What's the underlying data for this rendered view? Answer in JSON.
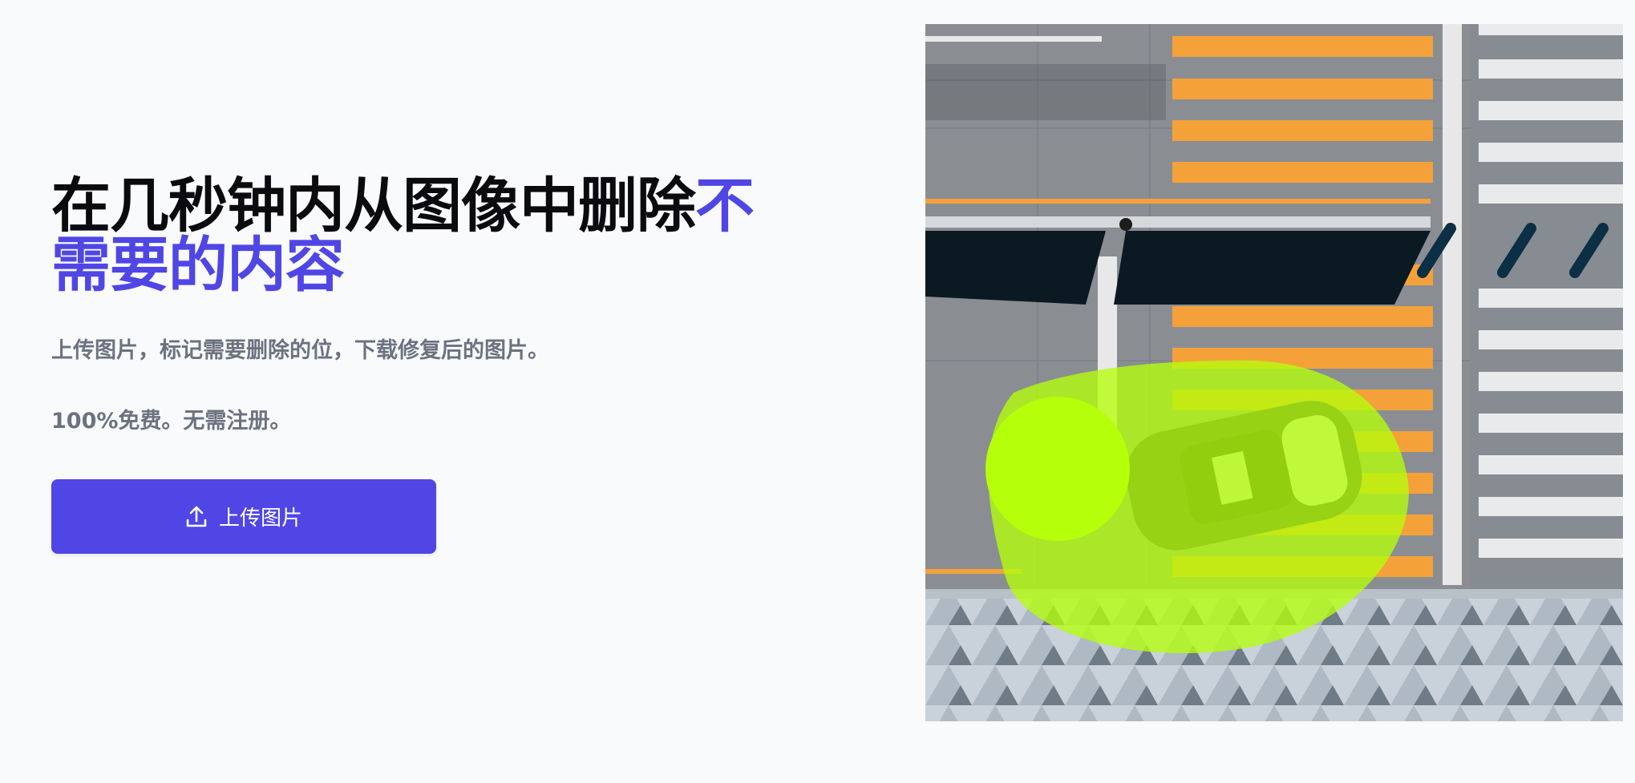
{
  "hero": {
    "headline_main": "在几秒钟内从图像中删除",
    "headline_accent": "不需要的内容",
    "subtitle": "上传图片，标记需要删除的位，下载修复后的图片。",
    "free_note": "100%免费。无需注册。"
  },
  "upload_button": {
    "label": "上传图片",
    "icon": "upload-icon"
  },
  "demo_image": {
    "description_icon": "street-aerial-image"
  },
  "colors": {
    "accent": "#4f46e5",
    "text": "#0b0b0f",
    "muted": "#6b7280",
    "mask": "#b5ff0a"
  }
}
